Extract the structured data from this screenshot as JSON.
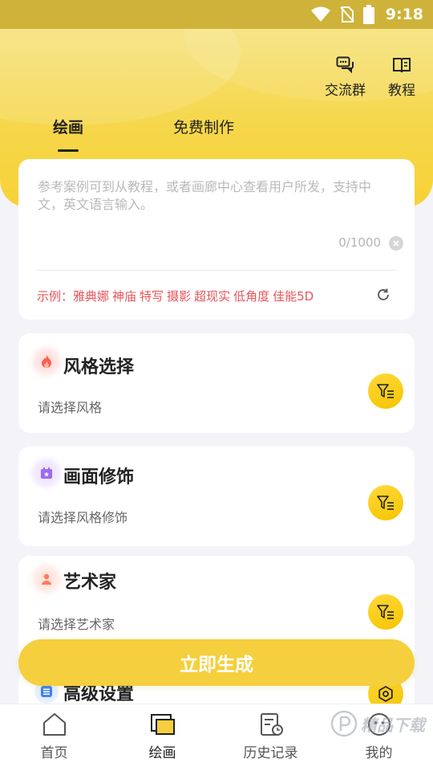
{
  "status_bar": {
    "time": "9:18",
    "icons": [
      "wifi-icon",
      "no-sim-icon",
      "battery-icon"
    ]
  },
  "header": {
    "actions": [
      {
        "label": "交流群",
        "icon": "chat-icon"
      },
      {
        "label": "教程",
        "icon": "book-icon"
      }
    ],
    "tabs": [
      {
        "label": "绘画",
        "active": true
      },
      {
        "label": "免费制作",
        "active": false
      }
    ]
  },
  "prompt": {
    "placeholder": "参考案例可到从教程，或者画廊中心查看用户所发，支持中文，英文语言输入。",
    "counter": "0/1000",
    "example_prefix": "示例：",
    "examples": [
      "雅典娜",
      "神庙",
      "特写",
      "摄影",
      "超现实",
      "低角度",
      "佳能5D"
    ]
  },
  "options": [
    {
      "title": "风格选择",
      "subtitle": "请选择风格",
      "icon": "flame-icon"
    },
    {
      "title": "画面修饰",
      "subtitle": "请选择风格修饰",
      "icon": "calendar-star-icon"
    },
    {
      "title": "艺术家",
      "subtitle": "请选择艺术家",
      "icon": "artist-icon"
    },
    {
      "title": "高级设置",
      "subtitle": "",
      "icon": "list-icon"
    }
  ],
  "generate_label": "立即生成",
  "bottom_nav": [
    {
      "label": "首页",
      "icon": "home-icon",
      "active": false
    },
    {
      "label": "绘画",
      "icon": "canvas-icon",
      "active": true
    },
    {
      "label": "历史记录",
      "icon": "history-icon",
      "active": false
    },
    {
      "label": "我的",
      "icon": "profile-icon",
      "active": false
    }
  ],
  "watermark": "精品下载",
  "colors": {
    "accent": "#f5cf3d",
    "example_text": "#e5555a",
    "header": "#f6d74a"
  }
}
